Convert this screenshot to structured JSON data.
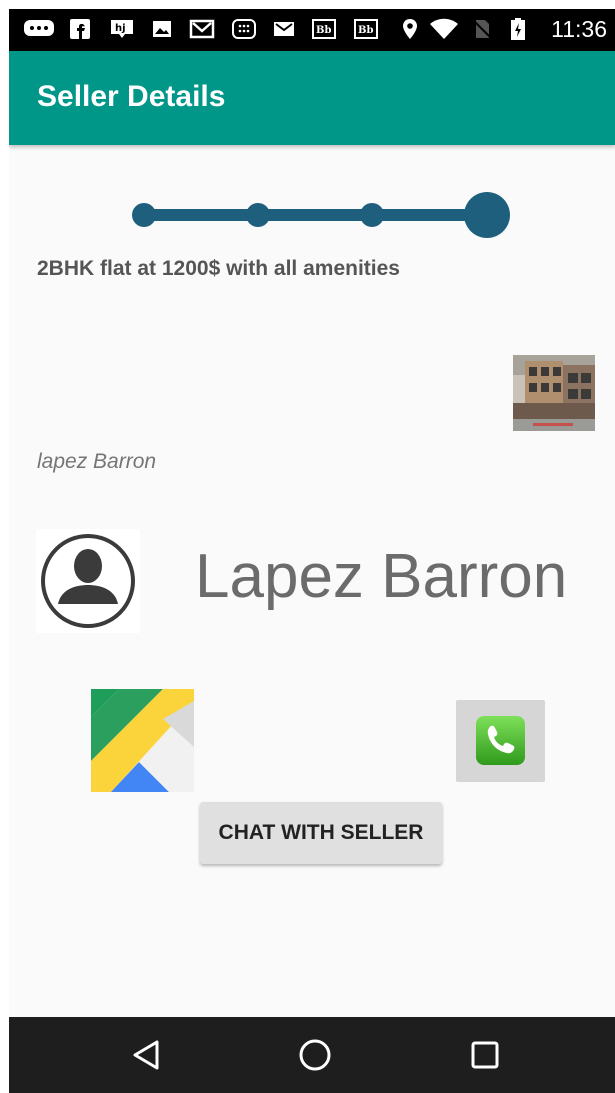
{
  "status_bar": {
    "time": "11:36",
    "icons": [
      "chat-bubble-icon",
      "facebook-icon",
      "hj-icon",
      "image-icon",
      "gmail-icon",
      "calculator-icon",
      "gmail-icon",
      "blackboard-icon",
      "blackboard-icon",
      "location-pin-icon",
      "wifi-icon",
      "no-sim-icon",
      "battery-charging-icon"
    ]
  },
  "app_bar": {
    "title": "Seller Details"
  },
  "progress": {
    "steps": 4,
    "current_step": 4
  },
  "listing": {
    "description": "2BHK flat at 1200$ with all amenities",
    "seller_username": "lapez Barron"
  },
  "seller": {
    "name": "Lapez Barron"
  },
  "actions": {
    "chat_label": "CHAT WITH SELLER"
  },
  "colors": {
    "app_bar": "#009688",
    "stepper": "#1e5f7e",
    "button": "#e0e0e0",
    "nav_bar": "#1e1e1e"
  }
}
